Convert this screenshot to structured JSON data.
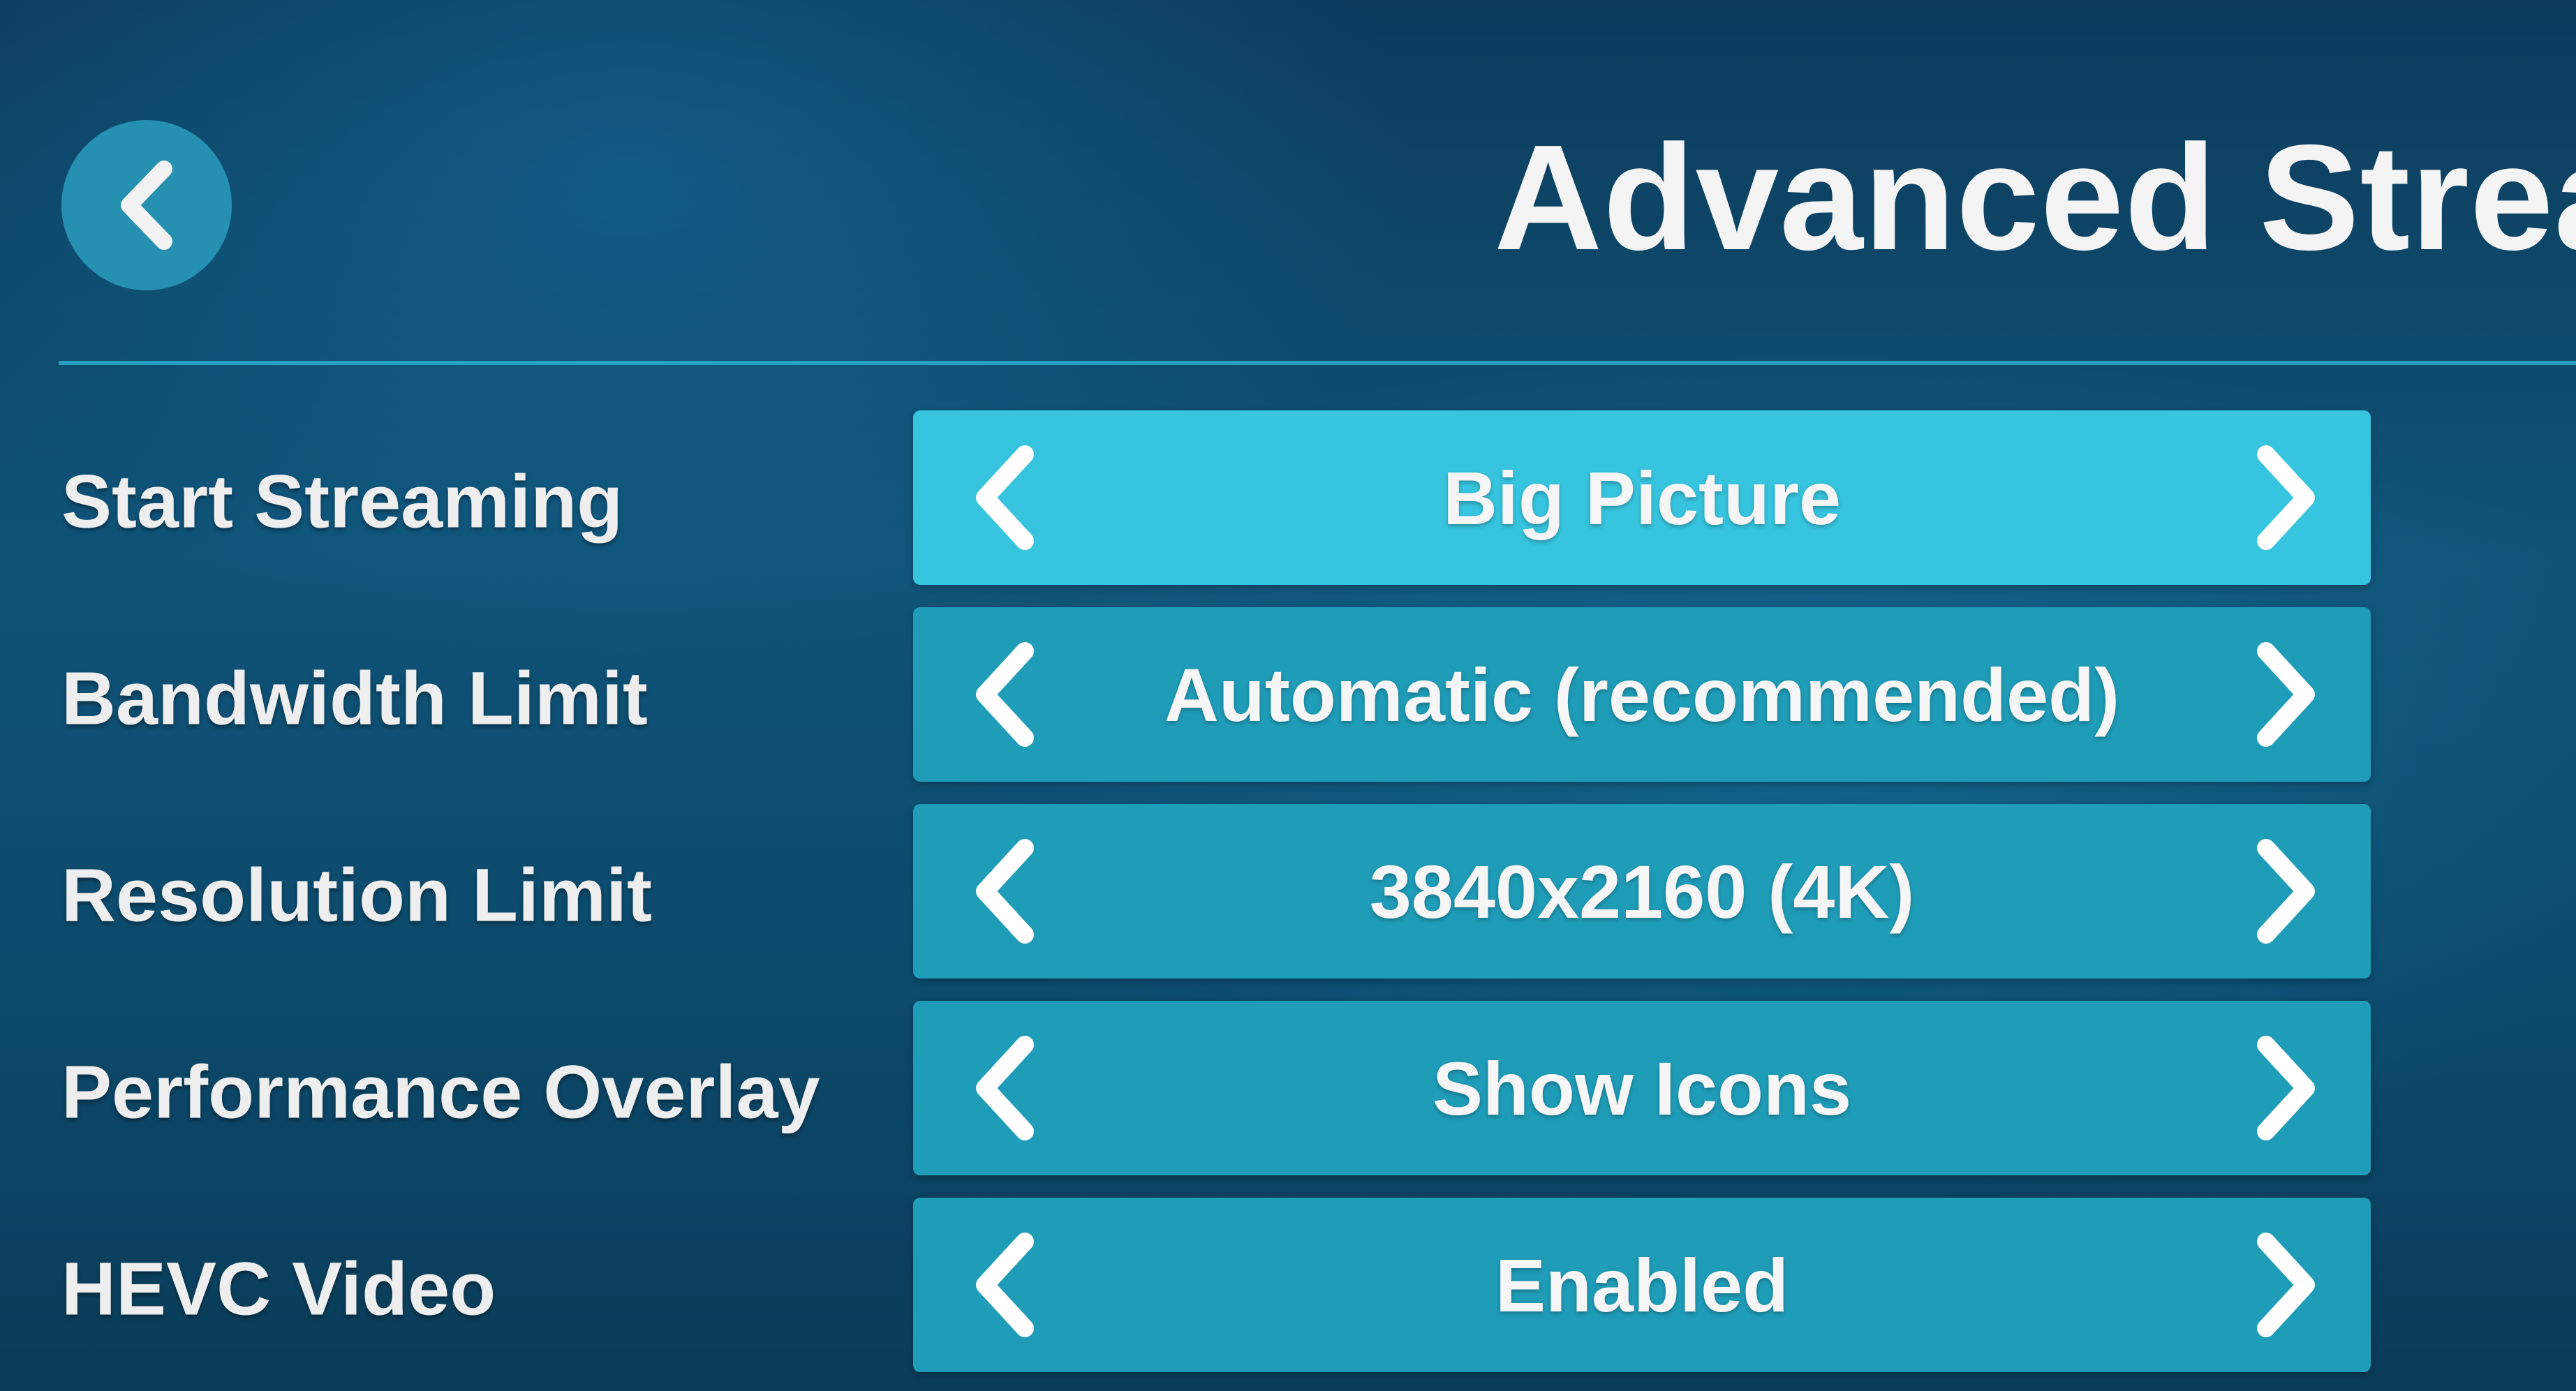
{
  "header": {
    "title": "Advanced Stream",
    "back_icon": "chevron-left-icon"
  },
  "colors": {
    "background": "#0f5378",
    "accent": "#2aa7c6",
    "selector": "#1f9cb8",
    "selector_focused": "#36c4de",
    "back_button": "#2590b0"
  },
  "settings": [
    {
      "label": "Start Streaming",
      "value": "Big Picture",
      "focused": true
    },
    {
      "label": "Bandwidth Limit",
      "value": "Automatic (recommended)",
      "focused": false
    },
    {
      "label": "Resolution Limit",
      "value": "3840x2160 (4K)",
      "focused": false
    },
    {
      "label": "Performance Overlay",
      "value": "Show Icons",
      "focused": false
    },
    {
      "label": "HEVC Video",
      "value": "Enabled",
      "focused": false
    }
  ]
}
